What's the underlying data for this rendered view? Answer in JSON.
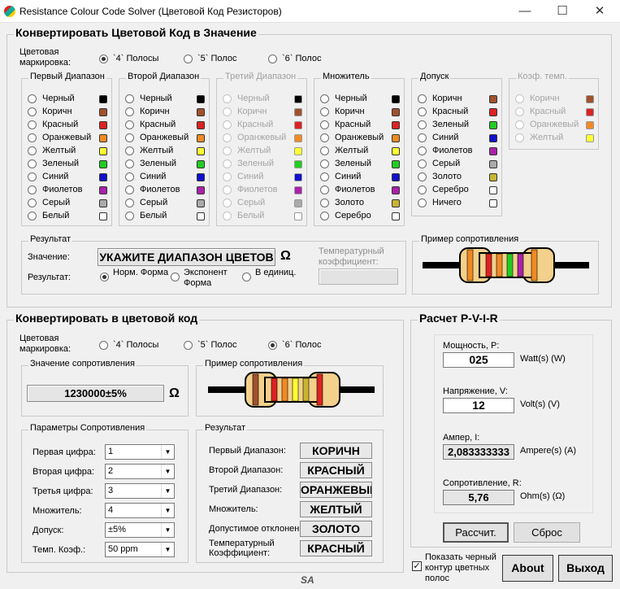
{
  "window": {
    "title": "Resistance Colour Code Solver (Цветовой Код Резисторов)",
    "minimize": "—",
    "maximize": "☐",
    "close": "✕"
  },
  "convert_to_value": {
    "title": "Конвертировать Цветовой Код в Значение",
    "marking_label": "Цветовая маркировка:",
    "modes": [
      "`4` Полосы",
      "`5` Полос",
      "`6` Полос"
    ],
    "selected_mode": 0,
    "groups": [
      {
        "title": "Первый Диапазон",
        "disabled": false,
        "items": [
          {
            "label": "Черный",
            "color": "#000000"
          },
          {
            "label": "Коричн",
            "color": "#a0522d"
          },
          {
            "label": "Красный",
            "color": "#dd2222"
          },
          {
            "label": "Оранжевый",
            "color": "#f08a24"
          },
          {
            "label": "Желтый",
            "color": "#ffff33"
          },
          {
            "label": "Зеленый",
            "color": "#22cc22"
          },
          {
            "label": "Синий",
            "color": "#1111cc"
          },
          {
            "label": "Фиолетов",
            "color": "#aa22aa"
          },
          {
            "label": "Серый",
            "color": "#aaaaaa"
          },
          {
            "label": "Белый",
            "color": "#ffffff"
          }
        ]
      },
      {
        "title": "Второй Диапазон",
        "disabled": false,
        "items": [
          {
            "label": "Черный",
            "color": "#000000"
          },
          {
            "label": "Коричн",
            "color": "#a0522d"
          },
          {
            "label": "Красный",
            "color": "#dd2222"
          },
          {
            "label": "Оранжевый",
            "color": "#f08a24"
          },
          {
            "label": "Желтый",
            "color": "#ffff33"
          },
          {
            "label": "Зеленый",
            "color": "#22cc22"
          },
          {
            "label": "Синий",
            "color": "#1111cc"
          },
          {
            "label": "Фиолетов",
            "color": "#aa22aa"
          },
          {
            "label": "Серый",
            "color": "#aaaaaa"
          },
          {
            "label": "Белый",
            "color": "#ffffff"
          }
        ]
      },
      {
        "title": "Третий Диапазон",
        "disabled": true,
        "items": [
          {
            "label": "Черный",
            "color": "#000000"
          },
          {
            "label": "Коричн",
            "color": "#a0522d"
          },
          {
            "label": "Красный",
            "color": "#dd2222"
          },
          {
            "label": "Оранжевый",
            "color": "#f08a24"
          },
          {
            "label": "Желтый",
            "color": "#ffff33"
          },
          {
            "label": "Зеленый",
            "color": "#22cc22"
          },
          {
            "label": "Синий",
            "color": "#1111cc"
          },
          {
            "label": "Фиолетов",
            "color": "#aa22aa"
          },
          {
            "label": "Серый",
            "color": "#aaaaaa"
          },
          {
            "label": "Белый",
            "color": "#ffffff"
          }
        ]
      },
      {
        "title": "Множитель",
        "disabled": false,
        "items": [
          {
            "label": "Черный",
            "color": "#000000"
          },
          {
            "label": "Коричн",
            "color": "#a0522d"
          },
          {
            "label": "Красный",
            "color": "#dd2222"
          },
          {
            "label": "Оранжевый",
            "color": "#f08a24"
          },
          {
            "label": "Желтый",
            "color": "#ffff33"
          },
          {
            "label": "Зеленый",
            "color": "#22cc22"
          },
          {
            "label": "Синий",
            "color": "#1111cc"
          },
          {
            "label": "Фиолетов",
            "color": "#aa22aa"
          },
          {
            "label": "Золото",
            "color": "#c8b432"
          },
          {
            "label": "Серебро",
            "color": "#ffffff"
          }
        ]
      },
      {
        "title": "Допуск",
        "disabled": false,
        "items": [
          {
            "label": "Коричн",
            "color": "#a0522d"
          },
          {
            "label": "Красный",
            "color": "#dd2222"
          },
          {
            "label": "Зеленый",
            "color": "#22cc22"
          },
          {
            "label": "Синий",
            "color": "#1111cc"
          },
          {
            "label": "Фиолетов",
            "color": "#aa22aa"
          },
          {
            "label": "Серый",
            "color": "#aaaaaa"
          },
          {
            "label": "Золото",
            "color": "#c8b432"
          },
          {
            "label": "Серебро",
            "color": "#ffffff"
          },
          {
            "label": "Ничего",
            "color": "#ffffff"
          }
        ]
      },
      {
        "title": "Коэф. темп.",
        "disabled": true,
        "items": [
          {
            "label": "Коричн",
            "color": "#a0522d"
          },
          {
            "label": "Красный",
            "color": "#dd2222"
          },
          {
            "label": "Оранжевый",
            "color": "#f08a24"
          },
          {
            "label": "Желтый",
            "color": "#ffff33"
          }
        ]
      }
    ],
    "result": {
      "title": "Результат",
      "value_label": "Значение:",
      "value": "УКАЖИТЕ ДИАПАЗОН ЦВЕТОВ",
      "ohm": "Ω",
      "result_label": "Результат:",
      "formats": [
        "Норм. Форма",
        "Экспонент Форма",
        "В единиц."
      ],
      "selected_format": 0,
      "temp_label": "Температурный коэффициент:",
      "temp_value": ""
    },
    "example": {
      "title": "Пример сопротивления",
      "bands": [
        "#f08a24",
        "#dd2222",
        "#f08a24",
        "#22cc22",
        "#aa22aa",
        "#f08a24"
      ]
    }
  },
  "convert_to_color": {
    "title": "Конвертировать в цветовой код",
    "marking_label": "Цветовая маркировка:",
    "modes": [
      "`4` Полосы",
      "`5` Полос",
      "`6` Полос"
    ],
    "selected_mode": 2,
    "resistance": {
      "title": "Значение сопротивления",
      "value": "1230000±5%",
      "ohm": "Ω"
    },
    "example": {
      "title": "Пример сопротивления",
      "bands": [
        "#a0522d",
        "#dd2222",
        "#f08a24",
        "#ffff33",
        "#c8b432",
        "#dd2222"
      ]
    },
    "params": {
      "title": "Параметры Сопротивления",
      "rows": [
        {
          "label": "Первая цифра:",
          "value": "1"
        },
        {
          "label": "Вторая цифра:",
          "value": "2"
        },
        {
          "label": "Третья цифра:",
          "value": "3"
        },
        {
          "label": "Множитель:",
          "value": "4"
        },
        {
          "label": "Допуск:",
          "value": "±5%"
        },
        {
          "label": "Темп. Коэф.:",
          "value": "50 ppm"
        }
      ]
    },
    "result": {
      "title": "Результат",
      "rows": [
        {
          "label": "Первый Диапазон:",
          "value": "КОРИЧН"
        },
        {
          "label": "Второй Диапазон:",
          "value": "КРАСНЫЙ"
        },
        {
          "label": "Третий Диапазон:",
          "value": "ОРАНЖЕВЫЙ"
        },
        {
          "label": "Множитель:",
          "value": "ЖЕЛТЫЙ"
        },
        {
          "label": "Допустимое отклонение:",
          "value": "ЗОЛОТО"
        },
        {
          "label": "Температурный Коэффициент:",
          "value": "КРАСНЫЙ"
        }
      ]
    }
  },
  "pvir": {
    "title": "Расчет P-V-I-R",
    "power": {
      "label": "Мощность, P:",
      "value": "025",
      "unit": "Watt(s) (W)"
    },
    "voltage": {
      "label": "Напряжение, V:",
      "value": "12",
      "unit": "Volt(s) (V)"
    },
    "current": {
      "label": "Ампер, I:",
      "value": "2,083333333",
      "unit": "Ampere(s) (A)"
    },
    "resistance": {
      "label": "Сопротивление, R:",
      "value": "5,76",
      "unit": "Ohm(s) (Ω)"
    },
    "calc_button": "Рассчит.",
    "reset_button": "Сброс"
  },
  "footer": {
    "black_outline_label": "Показать черный контур цветных полос",
    "black_outline_checked": true,
    "about": "About",
    "exit": "Выход",
    "logo": "SA"
  }
}
